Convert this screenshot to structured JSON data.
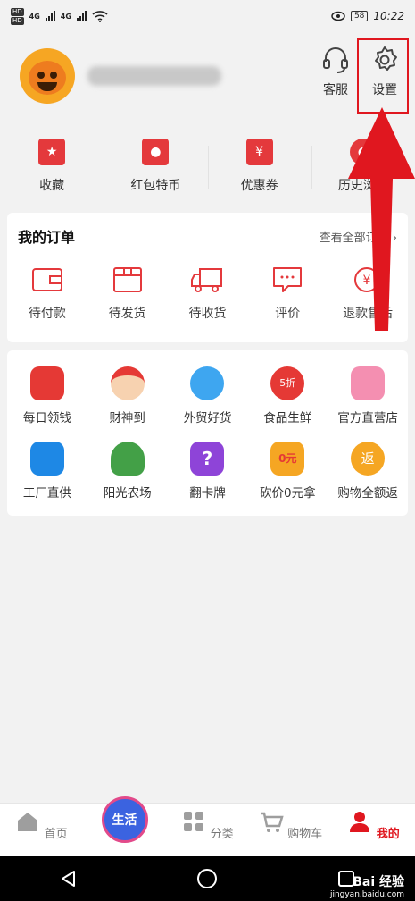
{
  "status_bar": {
    "left_badges": [
      "HD",
      "HD"
    ],
    "network": [
      "4G",
      "4G"
    ],
    "battery": "58",
    "time": "10:22"
  },
  "header": {
    "service_label": "客服",
    "settings_label": "设置"
  },
  "quick_links": [
    {
      "label": "收藏",
      "icon": "bag-star-icon"
    },
    {
      "label": "红包特币",
      "icon": "red-envelope-icon"
    },
    {
      "label": "优惠券",
      "icon": "coupon-icon"
    },
    {
      "label": "历史浏览",
      "icon": "footprint-icon"
    }
  ],
  "orders": {
    "title": "我的订单",
    "view_all": "查看全部订单",
    "items": [
      {
        "label": "待付款",
        "icon": "wallet-icon"
      },
      {
        "label": "待发货",
        "icon": "box-icon"
      },
      {
        "label": "待收货",
        "icon": "truck-icon"
      },
      {
        "label": "评价",
        "icon": "comment-icon"
      },
      {
        "label": "退款售后",
        "icon": "refund-icon"
      }
    ]
  },
  "services": {
    "row1": [
      {
        "label": "每日领钱",
        "icon": "wallet-red-icon",
        "color": "#e53935"
      },
      {
        "label": "财神到",
        "icon": "fortune-god-icon",
        "color": "#f0b47a"
      },
      {
        "label": "外贸好货",
        "icon": "plane-globe-icon",
        "color": "#3ea6f0"
      },
      {
        "label": "食品生鲜",
        "icon": "apple-icon",
        "color": "#e53935"
      },
      {
        "label": "官方直营店",
        "icon": "store-icon",
        "color": "#f06292"
      }
    ],
    "row2": [
      {
        "label": "工厂直供",
        "icon": "factory-icon",
        "color": "#1e88e5"
      },
      {
        "label": "阳光农场",
        "icon": "tree-icon",
        "color": "#43a047"
      },
      {
        "label": "翻卡牌",
        "icon": "question-card-icon",
        "color": "#8e44d8"
      },
      {
        "label": "砍价0元拿",
        "icon": "gift-box-icon",
        "color": "#f5a623"
      },
      {
        "label": "购物全额返",
        "icon": "cashback-icon",
        "color": "#f5a623"
      }
    ]
  },
  "service_badges": {
    "apple_badge": "5折",
    "gift_badge": "0元",
    "cashback_badge": "返",
    "question_badge": "?"
  },
  "tabbar": {
    "items": [
      {
        "label": "首页",
        "icon": "home-icon"
      },
      {
        "label": "",
        "icon": "life-icon",
        "badge_text": "生活"
      },
      {
        "label": "分类",
        "icon": "grid-icon"
      },
      {
        "label": "购物车",
        "icon": "cart-icon"
      },
      {
        "label": "我的",
        "icon": "person-icon"
      }
    ]
  },
  "watermark": {
    "brand": "Bai 经验",
    "url": "jingyan.baidu.com"
  },
  "colors": {
    "accent": "#e0171f",
    "icon_red": "#e4393c"
  }
}
